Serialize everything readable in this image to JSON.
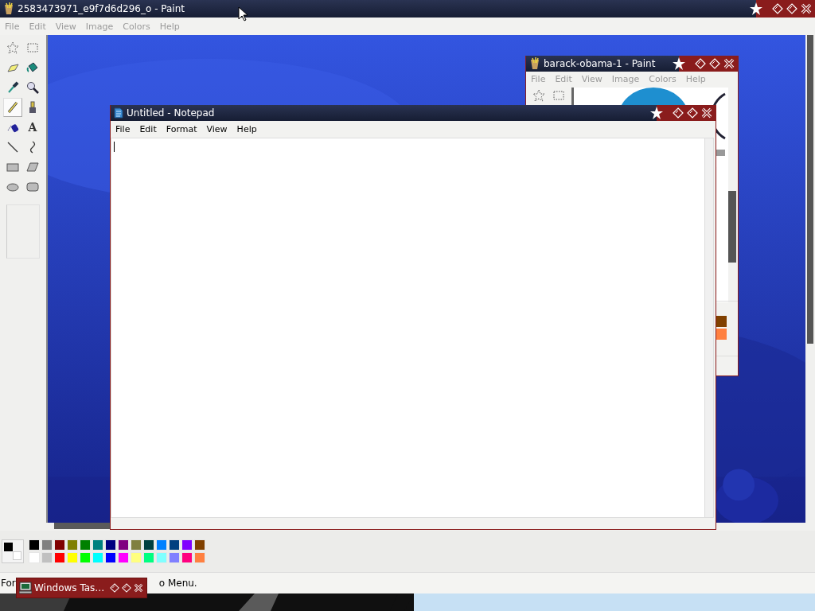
{
  "paint_main": {
    "title": "2583473971_e9f7d6d296_o - Paint",
    "menu": [
      {
        "label": "File",
        "disabled": true
      },
      {
        "label": "Edit",
        "disabled": true
      },
      {
        "label": "View",
        "disabled": true
      },
      {
        "label": "Image",
        "disabled": true
      },
      {
        "label": "Colors",
        "disabled": true
      },
      {
        "label": "Help",
        "disabled": true
      }
    ],
    "tools": [
      {
        "kind": "free-select",
        "selected": false
      },
      {
        "kind": "rect-select",
        "selected": false
      },
      {
        "kind": "eraser",
        "selected": false
      },
      {
        "kind": "fill",
        "selected": false
      },
      {
        "kind": "picker",
        "selected": false
      },
      {
        "kind": "magnifier",
        "selected": false
      },
      {
        "kind": "pencil",
        "selected": true
      },
      {
        "kind": "brush",
        "selected": false
      },
      {
        "kind": "airbrush",
        "selected": false
      },
      {
        "kind": "text",
        "glyph": "A",
        "selected": false
      },
      {
        "kind": "line",
        "selected": false
      },
      {
        "kind": "curve",
        "selected": false
      },
      {
        "kind": "rectangle",
        "selected": false
      },
      {
        "kind": "polygon",
        "selected": false
      },
      {
        "kind": "ellipse",
        "selected": false
      },
      {
        "kind": "rounded-rect",
        "selected": false
      }
    ],
    "current_colors": [
      {
        "color": "#000000"
      },
      {
        "color": "#ffffff"
      }
    ],
    "palette": [
      {
        "color": "#000000"
      },
      {
        "color": "#808080"
      },
      {
        "color": "#800000"
      },
      {
        "color": "#808000"
      },
      {
        "color": "#008000"
      },
      {
        "color": "#008080"
      },
      {
        "color": "#000080"
      },
      {
        "color": "#800080"
      },
      {
        "color": "#808040"
      },
      {
        "color": "#004040"
      },
      {
        "color": "#0080ff"
      },
      {
        "color": "#004080"
      },
      {
        "color": "#8000ff"
      },
      {
        "color": "#804000"
      },
      {
        "color": "#ffffff"
      },
      {
        "color": "#c0c0c0"
      },
      {
        "color": "#ff0000"
      },
      {
        "color": "#ffff00"
      },
      {
        "color": "#00ff00"
      },
      {
        "color": "#00ffff"
      },
      {
        "color": "#0000ff"
      },
      {
        "color": "#ff00ff"
      },
      {
        "color": "#ffff80"
      },
      {
        "color": "#00ff80"
      },
      {
        "color": "#80ffff"
      },
      {
        "color": "#8080ff"
      },
      {
        "color": "#ff0080"
      },
      {
        "color": "#ff8040"
      }
    ],
    "status_bar": {
      "left": "For",
      "right": "o Menu."
    }
  },
  "paint_small": {
    "title": "barack-obama-1 - Paint",
    "menu": [
      {
        "label": "File",
        "disabled": true
      },
      {
        "label": "Edit",
        "disabled": true
      },
      {
        "label": "View",
        "disabled": true
      },
      {
        "label": "Image",
        "disabled": true
      },
      {
        "label": "Colors",
        "disabled": true
      },
      {
        "label": "Help",
        "disabled": true
      }
    ],
    "tools": [
      {
        "kind": "free-select",
        "selected": false
      },
      {
        "kind": "rect-select",
        "selected": false
      }
    ],
    "palette": [
      {
        "color": "#804000"
      },
      {
        "color": "#ff8040"
      }
    ]
  },
  "notepad": {
    "title": "Untitled - Notepad",
    "menu": [
      {
        "label": "File",
        "disabled": false
      },
      {
        "label": "Edit",
        "disabled": false
      },
      {
        "label": "Format",
        "disabled": false
      },
      {
        "label": "View",
        "disabled": false
      },
      {
        "label": "Help",
        "disabled": false
      }
    ]
  },
  "taskbar_button": {
    "label": "Windows Tas…"
  }
}
